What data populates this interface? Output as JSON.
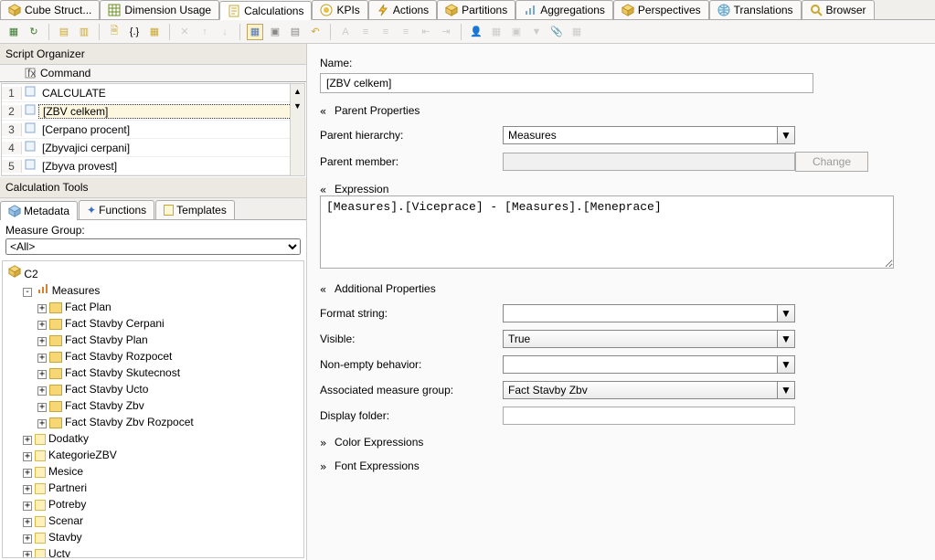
{
  "tabs": [
    "Cube Struct...",
    "Dimension Usage",
    "Calculations",
    "KPIs",
    "Actions",
    "Partitions",
    "Aggregations",
    "Perspectives",
    "Translations",
    "Browser"
  ],
  "active_tab": 2,
  "left": {
    "script_organizer_title": "Script Organizer",
    "command_header": "Command",
    "commands": [
      {
        "idx": "1",
        "text": "CALCULATE"
      },
      {
        "idx": "2",
        "text": "[ZBV celkem]",
        "selected": true
      },
      {
        "idx": "3",
        "text": "[Cerpano procent]"
      },
      {
        "idx": "4",
        "text": "[Zbyvajici cerpani]"
      },
      {
        "idx": "5",
        "text": "[Zbyva provest]"
      }
    ],
    "calc_tools_title": "Calculation Tools",
    "ctool_tabs": [
      "Metadata",
      "Functions",
      "Templates"
    ],
    "ctool_active": 0,
    "measure_group_label": "Measure Group:",
    "measure_group_value": "<All>",
    "tree_root": "C2",
    "tree_measures": "Measures",
    "tree_folders": [
      "Fact Plan",
      "Fact Stavby Cerpani",
      "Fact Stavby Plan",
      "Fact Stavby Rozpocet",
      "Fact Stavby Skutecnost",
      "Fact Stavby Ucto",
      "Fact Stavby Zbv",
      "Fact Stavby Zbv Rozpocet"
    ],
    "tree_dims": [
      "Dodatky",
      "KategorieZBV",
      "Mesice",
      "Partneri",
      "Potreby",
      "Scenar",
      "Stavby",
      "Ucty"
    ]
  },
  "right": {
    "name_label": "Name:",
    "name_value": "[ZBV celkem]",
    "parent_props": "Parent Properties",
    "parent_hierarchy_label": "Parent hierarchy:",
    "parent_hierarchy_value": "Measures",
    "parent_member_label": "Parent member:",
    "parent_member_value": "",
    "change_btn": "Change",
    "expression_label": "Expression",
    "expression_value": "[Measures].[Viceprace] - [Measures].[Meneprace]",
    "addl_props": "Additional Properties",
    "format_string_label": "Format string:",
    "format_string_value": "",
    "visible_label": "Visible:",
    "visible_value": "True",
    "nonempty_label": "Non-empty behavior:",
    "nonempty_value": "",
    "assoc_mg_label": "Associated measure group:",
    "assoc_mg_value": "Fact Stavby Zbv",
    "display_folder_label": "Display folder:",
    "display_folder_value": "",
    "color_expr": "Color Expressions",
    "font_expr": "Font Expressions"
  }
}
